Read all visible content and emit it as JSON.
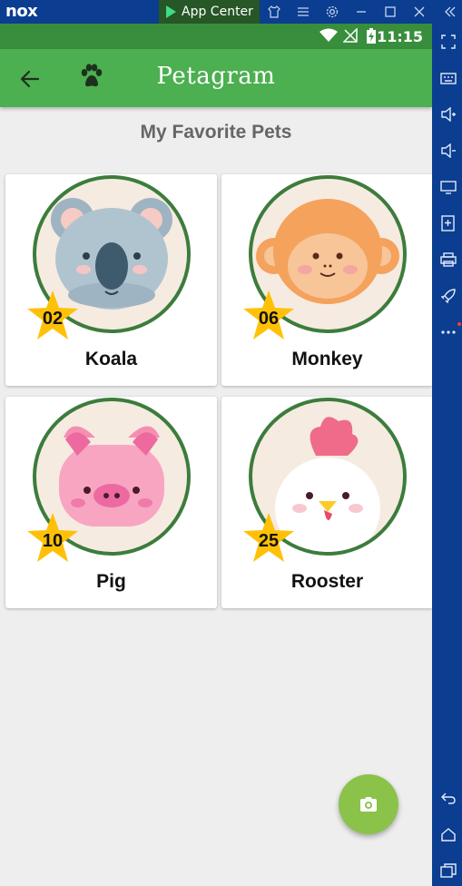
{
  "emulator": {
    "logo": "nox",
    "app_center_label": "App Center"
  },
  "status_bar": {
    "time": "11:15"
  },
  "app_bar": {
    "title": "Petagram"
  },
  "main": {
    "section_title": "My Favorite Pets",
    "pets": [
      {
        "name": "Koala",
        "likes": "02",
        "icon": "koala"
      },
      {
        "name": "Monkey",
        "likes": "06",
        "icon": "monkey"
      },
      {
        "name": "Pig",
        "likes": "10",
        "icon": "pig"
      },
      {
        "name": "Rooster",
        "likes": "25",
        "icon": "rooster"
      }
    ]
  },
  "colors": {
    "app_bar": "#4caf50",
    "status_bar": "#388e3c",
    "fab": "#8bc34a",
    "star": "#ffc107",
    "avatar_border": "#3c7c3c"
  },
  "fab": {
    "icon": "camera-icon"
  }
}
